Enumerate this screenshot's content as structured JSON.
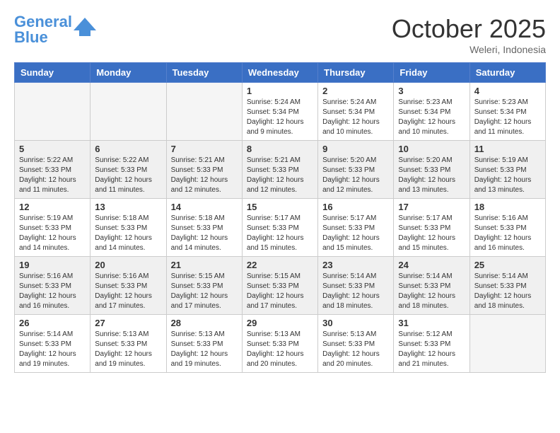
{
  "header": {
    "logo_general": "General",
    "logo_blue": "Blue",
    "month_title": "October 2025",
    "location": "Weleri, Indonesia"
  },
  "days_of_week": [
    "Sunday",
    "Monday",
    "Tuesday",
    "Wednesday",
    "Thursday",
    "Friday",
    "Saturday"
  ],
  "weeks": [
    {
      "shaded": false,
      "days": [
        {
          "number": "",
          "info": ""
        },
        {
          "number": "",
          "info": ""
        },
        {
          "number": "",
          "info": ""
        },
        {
          "number": "1",
          "info": "Sunrise: 5:24 AM\nSunset: 5:34 PM\nDaylight: 12 hours\nand 9 minutes."
        },
        {
          "number": "2",
          "info": "Sunrise: 5:24 AM\nSunset: 5:34 PM\nDaylight: 12 hours\nand 10 minutes."
        },
        {
          "number": "3",
          "info": "Sunrise: 5:23 AM\nSunset: 5:34 PM\nDaylight: 12 hours\nand 10 minutes."
        },
        {
          "number": "4",
          "info": "Sunrise: 5:23 AM\nSunset: 5:34 PM\nDaylight: 12 hours\nand 11 minutes."
        }
      ]
    },
    {
      "shaded": true,
      "days": [
        {
          "number": "5",
          "info": "Sunrise: 5:22 AM\nSunset: 5:33 PM\nDaylight: 12 hours\nand 11 minutes."
        },
        {
          "number": "6",
          "info": "Sunrise: 5:22 AM\nSunset: 5:33 PM\nDaylight: 12 hours\nand 11 minutes."
        },
        {
          "number": "7",
          "info": "Sunrise: 5:21 AM\nSunset: 5:33 PM\nDaylight: 12 hours\nand 12 minutes."
        },
        {
          "number": "8",
          "info": "Sunrise: 5:21 AM\nSunset: 5:33 PM\nDaylight: 12 hours\nand 12 minutes."
        },
        {
          "number": "9",
          "info": "Sunrise: 5:20 AM\nSunset: 5:33 PM\nDaylight: 12 hours\nand 12 minutes."
        },
        {
          "number": "10",
          "info": "Sunrise: 5:20 AM\nSunset: 5:33 PM\nDaylight: 12 hours\nand 13 minutes."
        },
        {
          "number": "11",
          "info": "Sunrise: 5:19 AM\nSunset: 5:33 PM\nDaylight: 12 hours\nand 13 minutes."
        }
      ]
    },
    {
      "shaded": false,
      "days": [
        {
          "number": "12",
          "info": "Sunrise: 5:19 AM\nSunset: 5:33 PM\nDaylight: 12 hours\nand 14 minutes."
        },
        {
          "number": "13",
          "info": "Sunrise: 5:18 AM\nSunset: 5:33 PM\nDaylight: 12 hours\nand 14 minutes."
        },
        {
          "number": "14",
          "info": "Sunrise: 5:18 AM\nSunset: 5:33 PM\nDaylight: 12 hours\nand 14 minutes."
        },
        {
          "number": "15",
          "info": "Sunrise: 5:17 AM\nSunset: 5:33 PM\nDaylight: 12 hours\nand 15 minutes."
        },
        {
          "number": "16",
          "info": "Sunrise: 5:17 AM\nSunset: 5:33 PM\nDaylight: 12 hours\nand 15 minutes."
        },
        {
          "number": "17",
          "info": "Sunrise: 5:17 AM\nSunset: 5:33 PM\nDaylight: 12 hours\nand 15 minutes."
        },
        {
          "number": "18",
          "info": "Sunrise: 5:16 AM\nSunset: 5:33 PM\nDaylight: 12 hours\nand 16 minutes."
        }
      ]
    },
    {
      "shaded": true,
      "days": [
        {
          "number": "19",
          "info": "Sunrise: 5:16 AM\nSunset: 5:33 PM\nDaylight: 12 hours\nand 16 minutes."
        },
        {
          "number": "20",
          "info": "Sunrise: 5:16 AM\nSunset: 5:33 PM\nDaylight: 12 hours\nand 17 minutes."
        },
        {
          "number": "21",
          "info": "Sunrise: 5:15 AM\nSunset: 5:33 PM\nDaylight: 12 hours\nand 17 minutes."
        },
        {
          "number": "22",
          "info": "Sunrise: 5:15 AM\nSunset: 5:33 PM\nDaylight: 12 hours\nand 17 minutes."
        },
        {
          "number": "23",
          "info": "Sunrise: 5:14 AM\nSunset: 5:33 PM\nDaylight: 12 hours\nand 18 minutes."
        },
        {
          "number": "24",
          "info": "Sunrise: 5:14 AM\nSunset: 5:33 PM\nDaylight: 12 hours\nand 18 minutes."
        },
        {
          "number": "25",
          "info": "Sunrise: 5:14 AM\nSunset: 5:33 PM\nDaylight: 12 hours\nand 18 minutes."
        }
      ]
    },
    {
      "shaded": false,
      "days": [
        {
          "number": "26",
          "info": "Sunrise: 5:14 AM\nSunset: 5:33 PM\nDaylight: 12 hours\nand 19 minutes."
        },
        {
          "number": "27",
          "info": "Sunrise: 5:13 AM\nSunset: 5:33 PM\nDaylight: 12 hours\nand 19 minutes."
        },
        {
          "number": "28",
          "info": "Sunrise: 5:13 AM\nSunset: 5:33 PM\nDaylight: 12 hours\nand 19 minutes."
        },
        {
          "number": "29",
          "info": "Sunrise: 5:13 AM\nSunset: 5:33 PM\nDaylight: 12 hours\nand 20 minutes."
        },
        {
          "number": "30",
          "info": "Sunrise: 5:13 AM\nSunset: 5:33 PM\nDaylight: 12 hours\nand 20 minutes."
        },
        {
          "number": "31",
          "info": "Sunrise: 5:12 AM\nSunset: 5:33 PM\nDaylight: 12 hours\nand 21 minutes."
        },
        {
          "number": "",
          "info": ""
        }
      ]
    }
  ]
}
